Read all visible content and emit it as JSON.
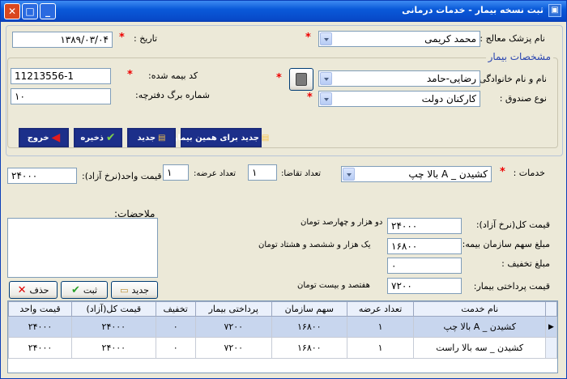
{
  "window": {
    "title": "ثبت نسخه بیمار - خدمات درمانی"
  },
  "header": {
    "doctor_label": "نام پزشک معالج :",
    "doctor_value": "محمد کریمی",
    "date_label": "تاریخ :",
    "date_value": "۱۳۸۹/۰۳/۰۴",
    "required_mark": "*"
  },
  "patient": {
    "legend": "مشخصات بیمار",
    "name_label": "نام و نام خانوادگی :",
    "name_value": "رضایی-حامد",
    "fund_label": "نوع صندوق :",
    "fund_value": "کارکنان دولت",
    "insurance_label": "کد بیمه شده:",
    "insurance_value": "11213556-1",
    "page_label": "شماره برگ دفترچه:",
    "page_value": "۱۰"
  },
  "actions": {
    "new_same": "جدید برای همین بیمار",
    "new": "جدید",
    "save": "ذخیره",
    "exit": "خروج"
  },
  "service": {
    "label": "خدمات :",
    "value": "کشیدن _ A بالا چپ",
    "request_count_label": "تعداد تقاضا:",
    "request_count_value": "۱",
    "offer_count_label": "تعداد عرضه:",
    "offer_count_value": "۱",
    "unit_price_label": "قیمت واحد(نرخ آزاد):",
    "unit_price_value": "۲۴۰۰۰"
  },
  "notes": {
    "label": "ملاحضات:"
  },
  "pricing": {
    "total_label": "قیمت کل(نرخ آزاد):",
    "total_value": "۲۴۰۰۰",
    "total_words": "دو هزار و چهارصد تومان",
    "org_share_label": "مبلغ سهم سازمان بیمه:",
    "org_share_value": "۱۶۸۰۰",
    "org_share_words": "یک هزار و ششصد و هشتاد تومان",
    "discount_label": "مبلغ تخفیف :",
    "discount_value": "۰",
    "patient_pay_label": "قیمت پرداختی بیمار:",
    "patient_pay_value": "۷۲۰۰",
    "patient_pay_words": "هفتصد و بیست تومان"
  },
  "row_actions": {
    "new": "جدید",
    "submit": "ثبت",
    "delete": "حذف"
  },
  "grid": {
    "headers": [
      "نام خدمت",
      "تعداد عرضه",
      "سهم سازمان",
      "پرداختی بیمار",
      "تخفیف",
      "قیمت کل(آزاد)",
      "قیمت واحد"
    ],
    "rows": [
      [
        "کشیدن _ A بالا چپ",
        "۱",
        "۱۶۸۰۰",
        "۷۲۰۰",
        "۰",
        "۲۴۰۰۰",
        "۲۴۰۰۰"
      ],
      [
        "کشیدن _ سه بالا راست",
        "۱",
        "۱۶۸۰۰",
        "۷۲۰۰",
        "۰",
        "۲۴۰۰۰",
        "۲۴۰۰۰"
      ]
    ]
  },
  "colors": {
    "title_bar": "#0a5ad9",
    "required": "#e00000",
    "legend": "#2a45b0",
    "selected_row": "#c8d6ee"
  }
}
